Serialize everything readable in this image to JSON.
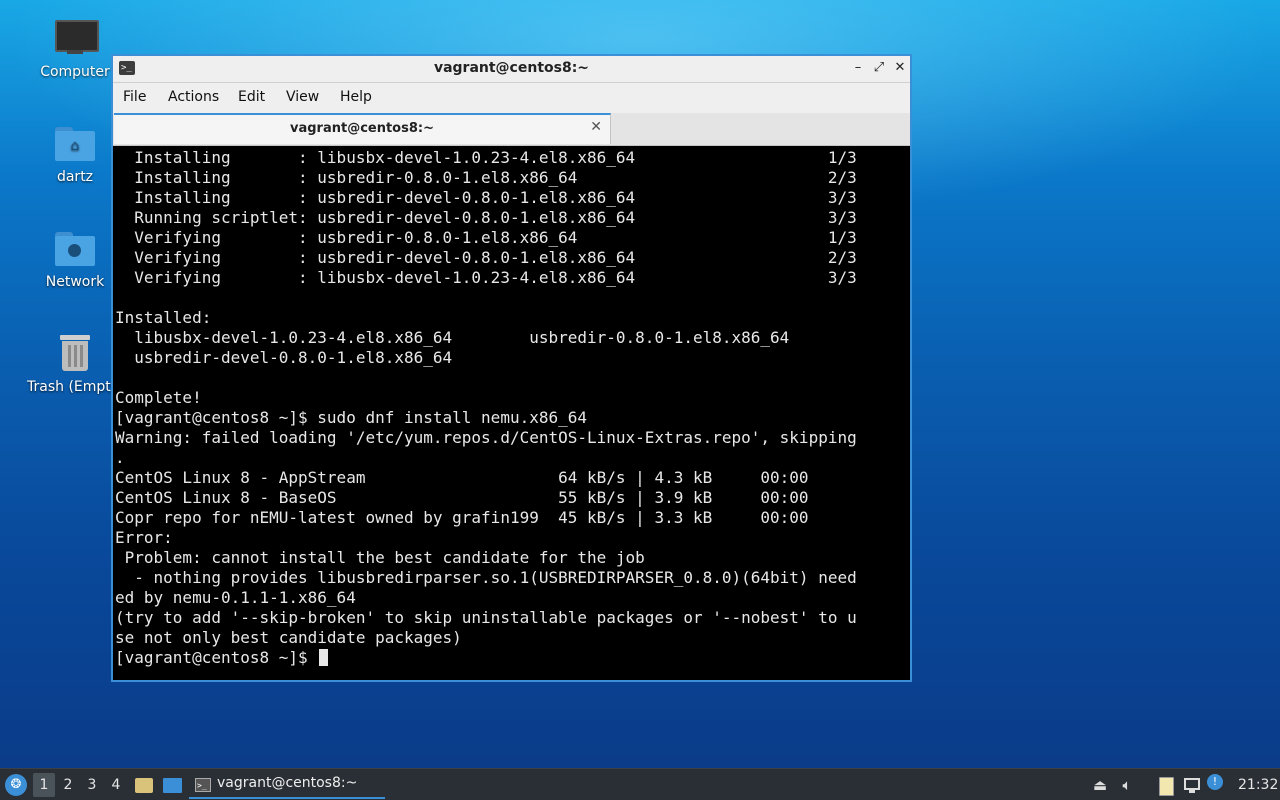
{
  "desktop": {
    "icons": [
      {
        "label": "Computer"
      },
      {
        "label": "dartz"
      },
      {
        "label": "Network"
      },
      {
        "label": "Trash (Empty)"
      }
    ]
  },
  "window": {
    "title": "vagrant@centos8:~",
    "controls": {
      "minimize": "–",
      "maximize": "⤢",
      "close": "✕"
    },
    "menu": [
      "File",
      "Actions",
      "Edit",
      "View",
      "Help"
    ],
    "tab": {
      "title": "vagrant@centos8:~",
      "close": "✕"
    }
  },
  "terminal": {
    "lines": [
      "  Installing       : libusbx-devel-1.0.23-4.el8.x86_64                    1/3",
      "  Installing       : usbredir-0.8.0-1.el8.x86_64                          2/3",
      "  Installing       : usbredir-devel-0.8.0-1.el8.x86_64                    3/3",
      "  Running scriptlet: usbredir-devel-0.8.0-1.el8.x86_64                    3/3",
      "  Verifying        : usbredir-0.8.0-1.el8.x86_64                          1/3",
      "  Verifying        : usbredir-devel-0.8.0-1.el8.x86_64                    2/3",
      "  Verifying        : libusbx-devel-1.0.23-4.el8.x86_64                    3/3",
      "",
      "Installed:",
      "  libusbx-devel-1.0.23-4.el8.x86_64        usbredir-0.8.0-1.el8.x86_64",
      "  usbredir-devel-0.8.0-1.el8.x86_64",
      "",
      "Complete!",
      "[vagrant@centos8 ~]$ sudo dnf install nemu.x86_64",
      "Warning: failed loading '/etc/yum.repos.d/CentOS-Linux-Extras.repo', skipping",
      ".",
      "CentOS Linux 8 - AppStream                    64 kB/s | 4.3 kB     00:00",
      "CentOS Linux 8 - BaseOS                       55 kB/s | 3.9 kB     00:00",
      "Copr repo for nEMU-latest owned by grafin199  45 kB/s | 3.3 kB     00:00",
      "Error:",
      " Problem: cannot install the best candidate for the job",
      "  - nothing provides libusbredirparser.so.1(USBREDIRPARSER_0.8.0)(64bit) need",
      "ed by nemu-0.1.1-1.x86_64",
      "(try to add '--skip-broken' to skip uninstallable packages or '--nobest' to u",
      "se not only best candidate packages)"
    ],
    "prompt": "[vagrant@centos8 ~]$ "
  },
  "taskbar": {
    "workspaces": [
      "1",
      "2",
      "3",
      "4"
    ],
    "active_task": "vagrant@centos8:~",
    "clock": "21:32"
  },
  "colors": {
    "accent": "#3b8fd6",
    "terminal_bg": "#000000",
    "terminal_fg": "#e8e8e8",
    "taskbar_bg": "#2a2f35"
  }
}
